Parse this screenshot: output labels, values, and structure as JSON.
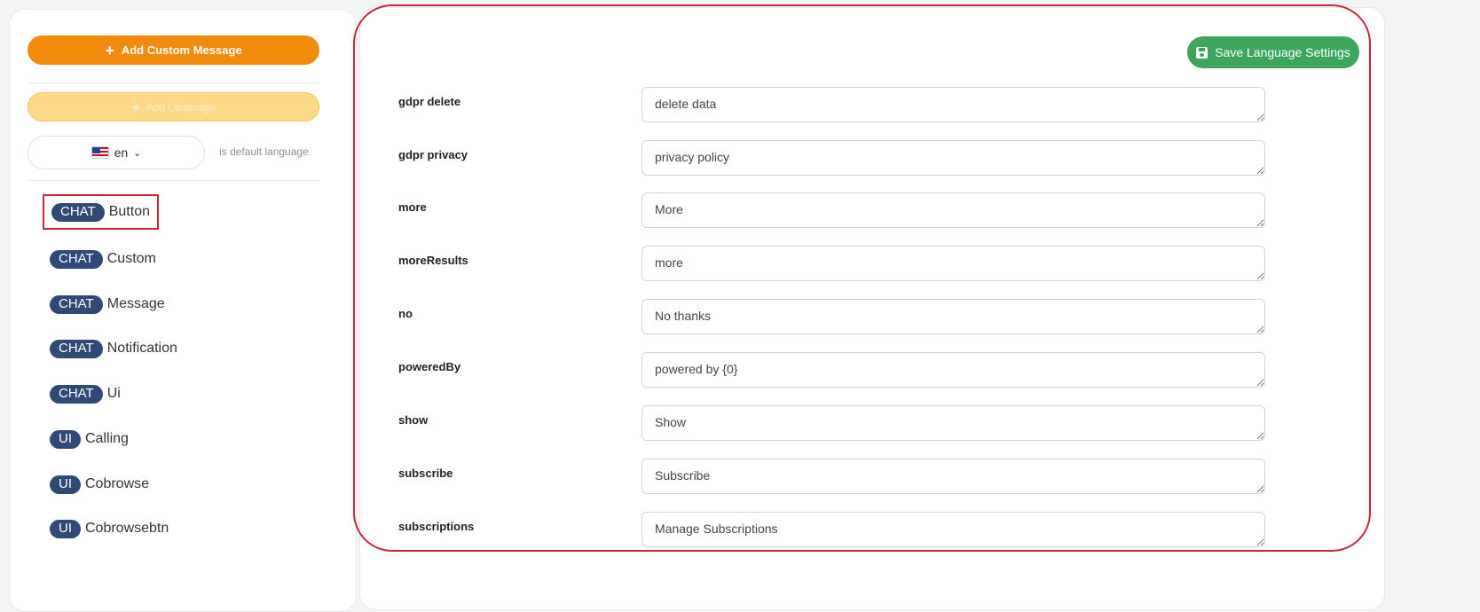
{
  "sidebar": {
    "add_custom_message_label": "Add Custom Message",
    "add_language_label": "Add Language",
    "language": {
      "code": "en",
      "default_note": "is default language"
    },
    "items": [
      {
        "badge": "CHAT",
        "label": "Button"
      },
      {
        "badge": "CHAT",
        "label": "Custom"
      },
      {
        "badge": "CHAT",
        "label": "Message"
      },
      {
        "badge": "CHAT",
        "label": "Notification"
      },
      {
        "badge": "CHAT",
        "label": "Ui"
      },
      {
        "badge": "UI",
        "label": "Calling"
      },
      {
        "badge": "UI",
        "label": "Cobrowse"
      },
      {
        "badge": "UI",
        "label": "Cobrowsebtn"
      }
    ]
  },
  "main": {
    "save_label": "Save Language Settings",
    "fields": [
      {
        "label": "gdpr delete",
        "value": "delete data"
      },
      {
        "label": "gdpr privacy",
        "value": "privacy policy"
      },
      {
        "label": "more",
        "value": "More"
      },
      {
        "label": "moreResults",
        "value": "more"
      },
      {
        "label": "no",
        "value": "No thanks"
      },
      {
        "label": "poweredBy",
        "value": "powered by {0}"
      },
      {
        "label": "show",
        "value": "Show"
      },
      {
        "label": "subscribe",
        "value": "Subscribe"
      },
      {
        "label": "subscriptions",
        "value": "Manage Subscriptions"
      }
    ]
  },
  "colors": {
    "accent_orange": "#f28b0c",
    "accent_green": "#3da65c",
    "badge_blue": "#2f4a77",
    "highlight_red": "#c6283a"
  }
}
